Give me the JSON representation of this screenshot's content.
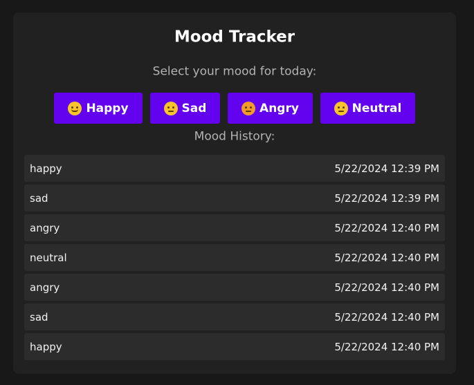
{
  "app": {
    "title": "Mood Tracker",
    "prompt": "Select your mood for today:",
    "history_label": "Mood History:"
  },
  "buttons": [
    {
      "label": "Happy",
      "icon": "smiling-face-icon"
    },
    {
      "label": "Sad",
      "icon": "pensive-face-icon"
    },
    {
      "label": "Angry",
      "icon": "angry-face-icon"
    },
    {
      "label": "Neutral",
      "icon": "pensive-face-icon"
    }
  ],
  "history": [
    {
      "mood": "happy",
      "time": "5/22/2024 12:39 PM"
    },
    {
      "mood": "sad",
      "time": "5/22/2024 12:39 PM"
    },
    {
      "mood": "angry",
      "time": "5/22/2024 12:40 PM"
    },
    {
      "mood": "neutral",
      "time": "5/22/2024 12:40 PM"
    },
    {
      "mood": "angry",
      "time": "5/22/2024 12:40 PM"
    },
    {
      "mood": "sad",
      "time": "5/22/2024 12:40 PM"
    },
    {
      "mood": "happy",
      "time": "5/22/2024 12:40 PM"
    }
  ],
  "colors": {
    "background": "#181818",
    "card": "#212121",
    "button": "#6202ee",
    "row": "#2c2c2c",
    "muted_text": "#b3b3b3",
    "text": "#ffffff"
  }
}
